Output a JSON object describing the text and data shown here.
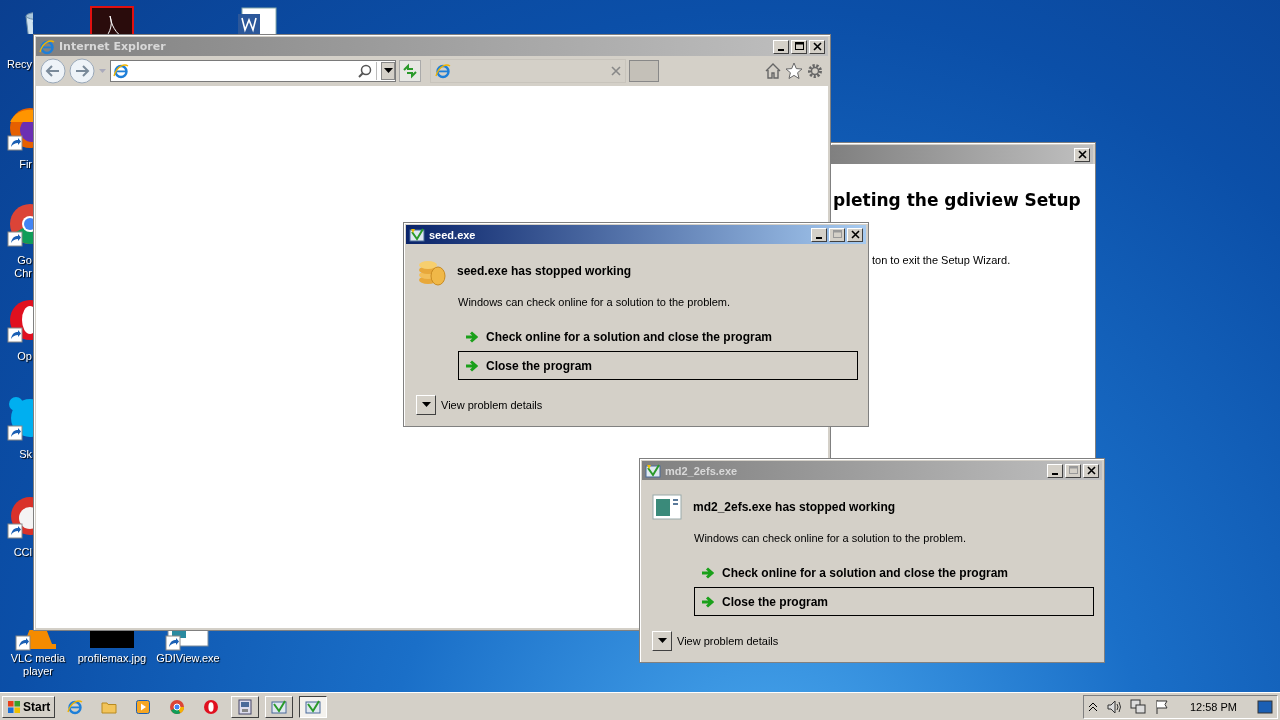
{
  "desktop_icons": [
    {
      "kind": "recycle",
      "label": "Recy"
    },
    {
      "kind": "acrobat"
    },
    {
      "kind": "word"
    },
    {
      "kind": "firefox",
      "label": "Fir",
      "shortcut": true
    },
    {
      "kind": "chrome",
      "label": "Go Chr",
      "shortcut": true
    },
    {
      "kind": "opera",
      "label": "Op",
      "shortcut": true
    },
    {
      "kind": "skype",
      "label": "Sk",
      "shortcut": true
    },
    {
      "kind": "ccleaner",
      "label": "CCl",
      "shortcut": true
    },
    {
      "kind": "vlc",
      "label": "VLC media player",
      "shortcut": true
    },
    {
      "kind": "image",
      "label": "profilemax.jpg",
      "shortcut": false
    },
    {
      "kind": "app",
      "label": "GDIView.exe",
      "shortcut": true
    }
  ],
  "browser": {
    "title": "Internet Explorer"
  },
  "setup_window": {
    "heading": "pleting the gdiview Setup",
    "text": "ton to exit the Setup Wizard."
  },
  "dialogs": [
    {
      "title": "seed.exe",
      "active": true,
      "heading": "seed.exe has stopped working",
      "message": "Windows can check online for a solution to the problem.",
      "options": [
        {
          "label": "Check online for a solution and close the program",
          "focused": false
        },
        {
          "label": "Close the program",
          "focused": true
        }
      ],
      "details": "View problem details"
    },
    {
      "title": "md2_2efs.exe",
      "active": false,
      "heading": "md2_2efs.exe has stopped working",
      "message": "Windows can check online for a solution to the problem.",
      "options": [
        {
          "label": "Check online for a solution and close the program",
          "focused": false
        },
        {
          "label": "Close the program",
          "focused": true
        }
      ],
      "details": "View problem details"
    }
  ],
  "taskbar": {
    "start": "Start",
    "items": [
      {
        "kind": "ie",
        "selected": false
      },
      {
        "kind": "folder",
        "selected": false
      },
      {
        "kind": "media",
        "selected": false
      },
      {
        "kind": "chrome",
        "selected": false
      },
      {
        "kind": "opera",
        "selected": false
      },
      {
        "kind": "setup",
        "selected": false
      },
      {
        "kind": "error",
        "selected": false
      },
      {
        "kind": "error",
        "selected": true
      }
    ],
    "clock": "12:58 PM"
  }
}
